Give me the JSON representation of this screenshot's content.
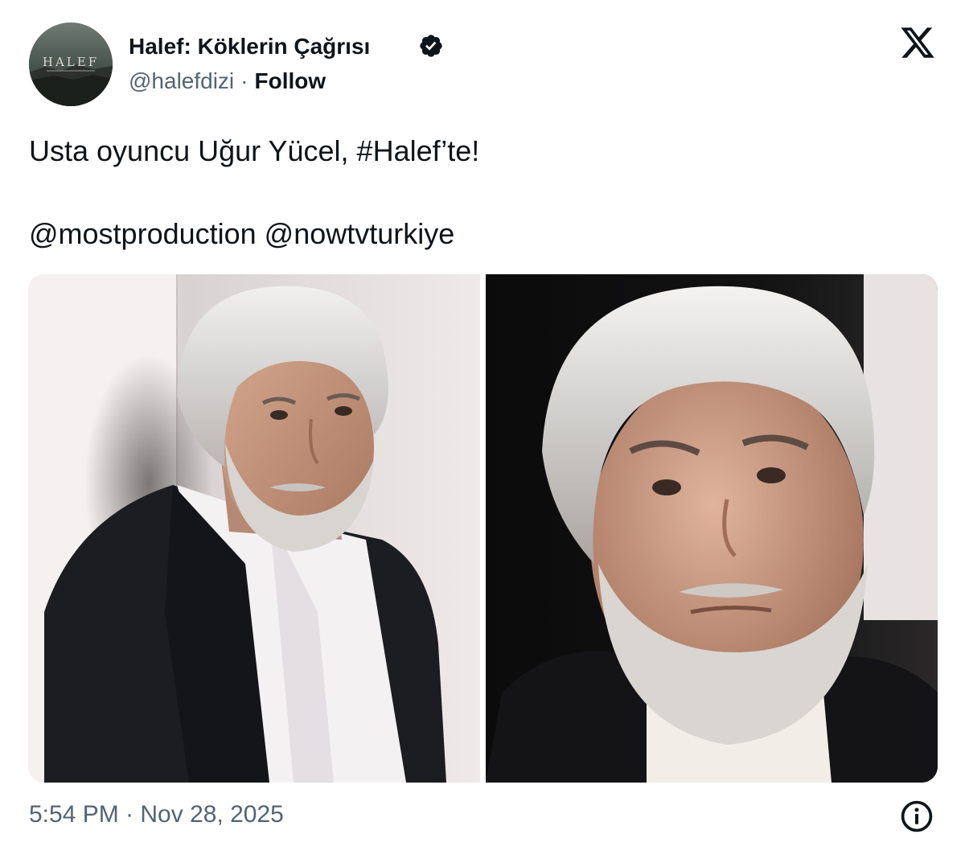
{
  "tweet": {
    "author": {
      "display_name": "Halef: Köklerin Çağrısı",
      "handle": "@halefdizi",
      "separator": "·",
      "follow_label": "Follow",
      "verified": true,
      "avatar_text": "HALEF",
      "avatar_icon": "halef-logo"
    },
    "platform_icon": "x-logo",
    "text": "Usta oyuncu Uğur Yücel, #Halef’te!",
    "mentions": "@mostproduction @nowtvturkiye",
    "media": {
      "count": 2,
      "items": [
        {
          "name": "photo-1",
          "subject": "older man with grey hair and beard, black blazer, white shirt, light background"
        },
        {
          "name": "photo-2",
          "subject": "close-up of older man with grey hair and beard, white turtleneck, dark background"
        }
      ]
    },
    "timestamp": "5:54 PM · Nov 28, 2025",
    "info_icon": "info-icon"
  },
  "colors": {
    "text_primary": "#0f1419",
    "text_secondary": "#536471",
    "verified_badge": "#0f1419"
  }
}
